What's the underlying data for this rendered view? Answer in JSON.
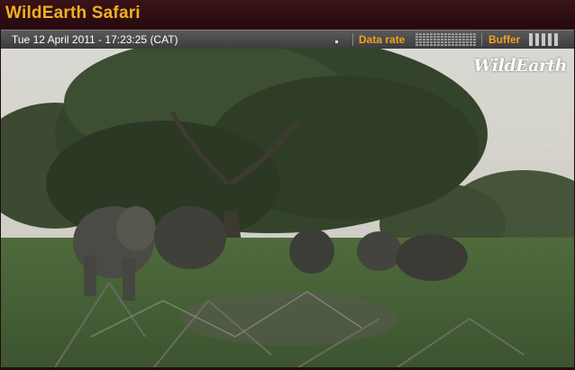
{
  "header": {
    "title": "WildEarth Safari"
  },
  "status": {
    "timestamp": "Tue 12 April 2011 - 17:23:25 (CAT)",
    "data_rate_label": "Data rate",
    "buffer_label": "Buffer"
  },
  "video": {
    "watermark": "WildEarth"
  },
  "colors": {
    "title": "#f0b020",
    "labels": "#f0a020",
    "background": "#200c10"
  }
}
